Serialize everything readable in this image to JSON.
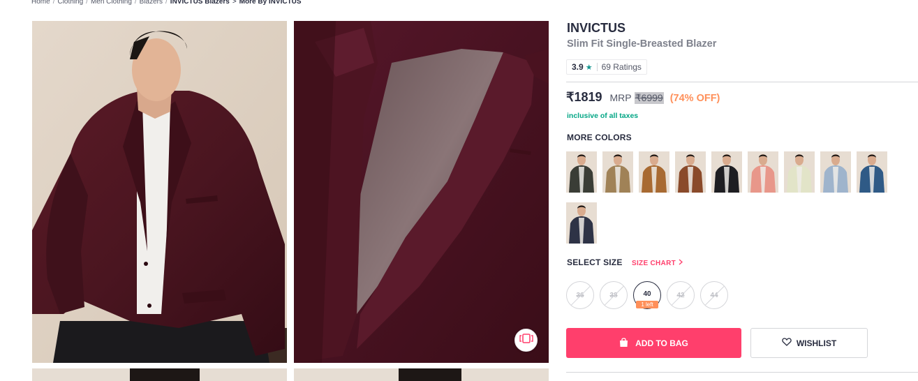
{
  "breadcrumb": [
    "Home",
    "Clothing",
    "Men Clothing",
    "Blazers",
    "INVICTUS Blazers",
    "More By INVICTUS"
  ],
  "breadcrumb_separator": "/",
  "breadcrumb_arrow": ">",
  "product": {
    "brand": "INVICTUS",
    "title": "Slim Fit Single-Breasted Blazer",
    "rating": "3.9",
    "star": "★",
    "rating_count": "69 Ratings",
    "price": "₹1819",
    "mrp_label": "MRP",
    "mrp": "₹6999",
    "discount": "(74% OFF)",
    "taxes_note": "inclusive of all taxes"
  },
  "more_colors": {
    "heading": "MORE COLORS",
    "swatches": [
      {
        "color": "#3a3d36"
      },
      {
        "color": "#a08257"
      },
      {
        "color": "#a86a32"
      },
      {
        "color": "#8a4a2a"
      },
      {
        "color": "#1e1e22"
      },
      {
        "color": "#e8978a"
      },
      {
        "color": "#e2e4c8"
      },
      {
        "color": "#9fb4cc"
      },
      {
        "color": "#2f5a86"
      },
      {
        "color": "#2e3346"
      }
    ]
  },
  "sizes": {
    "heading": "SELECT SIZE",
    "chart_label": "SIZE CHART",
    "items": [
      {
        "label": "36",
        "available": false
      },
      {
        "label": "38",
        "available": false
      },
      {
        "label": "40",
        "available": true,
        "stock_note": "1 left"
      },
      {
        "label": "42",
        "available": false
      },
      {
        "label": "44",
        "available": false
      }
    ]
  },
  "actions": {
    "add_to_bag": "ADD TO BAG",
    "wishlist": "WISHLIST"
  },
  "colors": {
    "accent": "#ff3f6c",
    "discount": "#ff905a",
    "tax_green": "#03a685",
    "rating_star": "#14958f",
    "blazer": "#4a1520"
  },
  "icons": [
    "shopping-bag-icon",
    "heart-icon",
    "chevron-right-icon",
    "similar-products-icon"
  ]
}
